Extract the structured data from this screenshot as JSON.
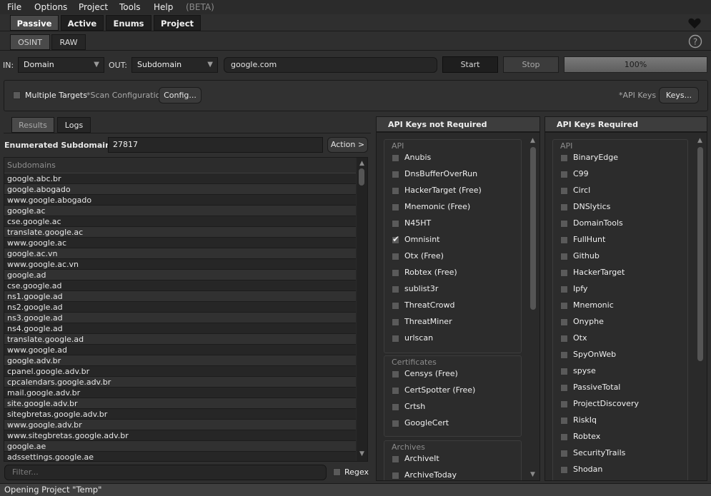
{
  "menubar": {
    "items": [
      "File",
      "Options",
      "Project",
      "Tools",
      "Help"
    ],
    "beta": "(BETA)"
  },
  "main_tabs": [
    "Passive",
    "Active",
    "Enums",
    "Project"
  ],
  "sub_tabs": [
    "OSINT",
    "RAW"
  ],
  "icons": {
    "heart": "heart-icon",
    "help": "help-circle-icon"
  },
  "scan": {
    "in_label": "IN:",
    "in_value": "Domain",
    "out_label": "OUT:",
    "out_value": "Subdomain",
    "target": "google.com",
    "start": "Start",
    "stop": "Stop",
    "progress_text": "100%",
    "progress_value": 1.0
  },
  "config": {
    "multiple_targets": "Multiple Targets",
    "scan_config_label": "*Scan Configuration",
    "config_button": "Config...",
    "api_keys_label": "*API Keys",
    "keys_button": "Keys..."
  },
  "results": {
    "tabs": [
      "Results",
      "Logs"
    ],
    "enum_label": "Enumerated Subdomains",
    "enum_count": "27817",
    "action": "Action >",
    "column_header": "Subdomains",
    "rows": [
      "google.abc.br",
      "google.abogado",
      "www.google.abogado",
      "google.ac",
      "cse.google.ac",
      "translate.google.ac",
      "www.google.ac",
      "google.ac.vn",
      "www.google.ac.vn",
      "google.ad",
      "cse.google.ad",
      "ns1.google.ad",
      "ns2.google.ad",
      "ns3.google.ad",
      "ns4.google.ad",
      "translate.google.ad",
      "www.google.ad",
      "google.adv.br",
      "cpanel.google.adv.br",
      "cpcalendars.google.adv.br",
      "mail.google.adv.br",
      "site.google.adv.br",
      "sitegbretas.google.adv.br",
      "www.google.adv.br",
      "www.sitegbretas.google.adv.br",
      "google.ae",
      "adssettings.google.ae"
    ],
    "filter_placeholder": "Filter...",
    "regex": "Regex"
  },
  "api_not_required": {
    "title": "API Keys not Required",
    "groups": [
      {
        "title": "API",
        "items": [
          {
            "label": "Anubis",
            "checked": false
          },
          {
            "label": "DnsBufferOverRun",
            "checked": false
          },
          {
            "label": "HackerTarget (Free)",
            "checked": false
          },
          {
            "label": "Mnemonic (Free)",
            "checked": false
          },
          {
            "label": "N45HT",
            "checked": false
          },
          {
            "label": "Omnisint",
            "checked": true
          },
          {
            "label": "Otx (Free)",
            "checked": false
          },
          {
            "label": "Robtex (Free)",
            "checked": false
          },
          {
            "label": "sublist3r",
            "checked": false
          },
          {
            "label": "ThreatCrowd",
            "checked": false
          },
          {
            "label": "ThreatMiner",
            "checked": false
          },
          {
            "label": "urlscan",
            "checked": false
          }
        ]
      },
      {
        "title": "Certificates",
        "items": [
          {
            "label": "Censys (Free)",
            "checked": false
          },
          {
            "label": "CertSpotter (Free)",
            "checked": false
          },
          {
            "label": "Crtsh",
            "checked": false
          },
          {
            "label": "GoogleCert",
            "checked": false
          }
        ]
      },
      {
        "title": "Archives",
        "items": [
          {
            "label": "ArchiveIt",
            "checked": false
          },
          {
            "label": "ArchiveToday",
            "checked": false
          }
        ]
      }
    ]
  },
  "api_required": {
    "title": "API Keys Required",
    "group_title": "API",
    "items": [
      "BinaryEdge",
      "C99",
      "Circl",
      "DNSlytics",
      "DomainTools",
      "FullHunt",
      "Github",
      "HackerTarget",
      "Ipfy",
      "Mnemonic",
      "Onyphe",
      "Otx",
      "SpyOnWeb",
      "spyse",
      "PassiveTotal",
      "ProjectDiscovery",
      "RiskIq",
      "Robtex",
      "SecurityTrails",
      "Shodan"
    ]
  },
  "status": "Opening Project \"Temp\""
}
